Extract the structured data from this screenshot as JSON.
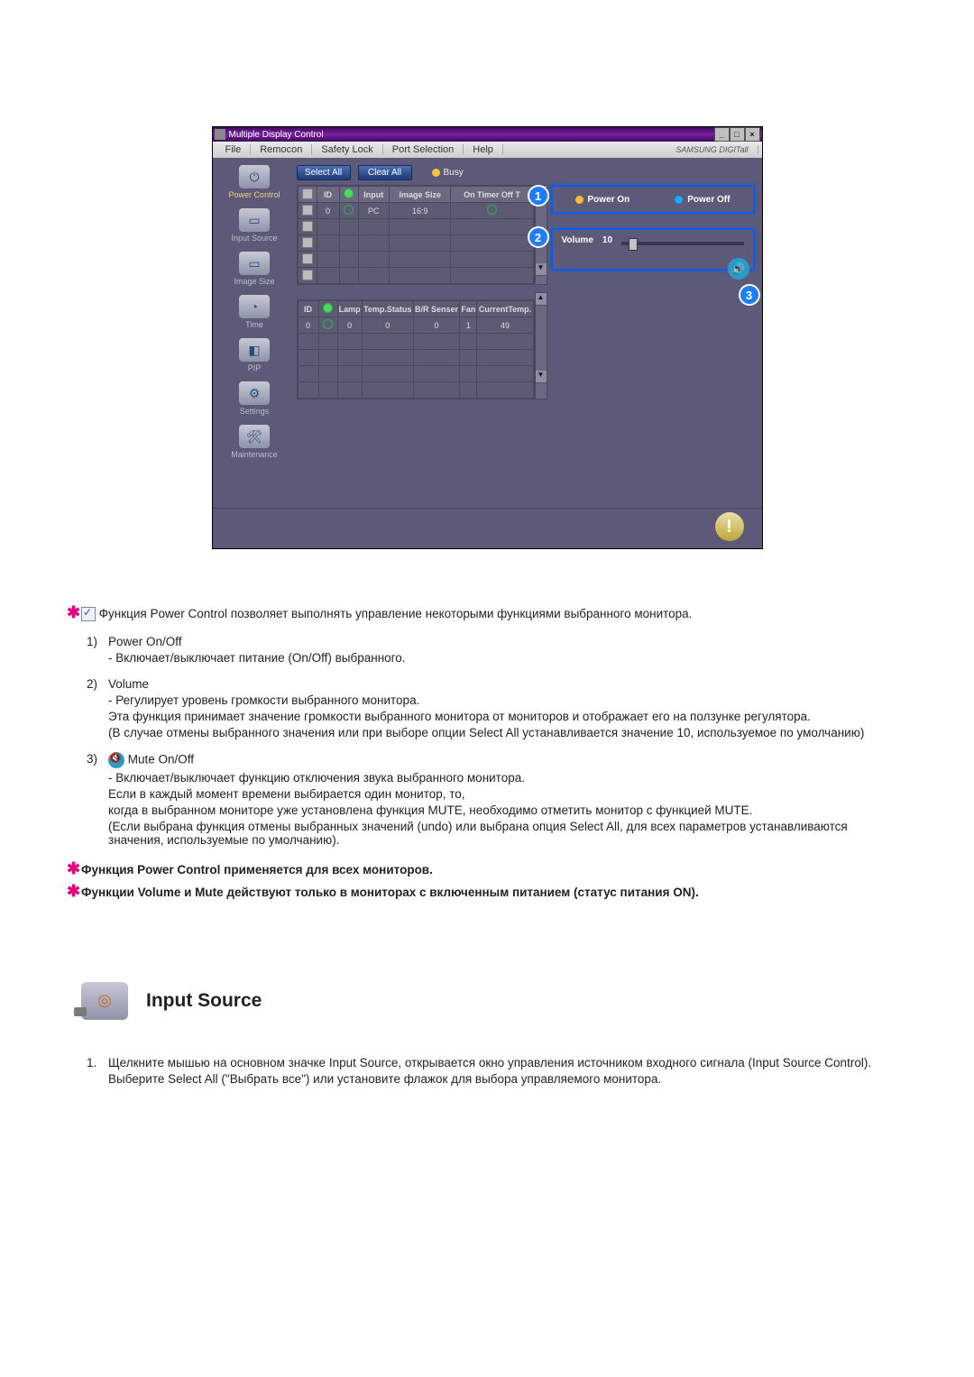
{
  "screenshot": {
    "title": "Multiple Display Control",
    "menu": [
      "File",
      "Remocon",
      "Safety Lock",
      "Port Selection",
      "Help"
    ],
    "brand": "SAMSUNG DIGITall",
    "sidebar": [
      {
        "label": "Power Control"
      },
      {
        "label": "Input Source"
      },
      {
        "label": "Image Size"
      },
      {
        "label": "Time"
      },
      {
        "label": "PIP"
      },
      {
        "label": "Settings"
      },
      {
        "label": "Maintenance"
      }
    ],
    "buttons": {
      "select_all": "Select All",
      "clear_all": "Clear All",
      "busy": "Busy"
    },
    "table1": {
      "headers": [
        "☑",
        "ID",
        "◉",
        "Input",
        "Image Size",
        "On Timer Off T"
      ],
      "rows": [
        [
          "",
          "0",
          "○",
          "PC",
          "16:9",
          "○"
        ],
        [
          "",
          "",
          "",
          "",
          "",
          ""
        ],
        [
          "",
          "",
          "",
          "",
          "",
          ""
        ],
        [
          "",
          "",
          "",
          "",
          "",
          ""
        ],
        [
          "",
          "",
          "",
          "",
          "",
          ""
        ]
      ]
    },
    "table2": {
      "headers": [
        "ID",
        "◉",
        "Lamp",
        "Temp.Status",
        "B/R Senser",
        "Fan",
        "CurrentTemp."
      ],
      "rows": [
        [
          "0",
          "○",
          "0",
          "0",
          "0",
          "1",
          "49"
        ],
        [
          "",
          "",
          "",
          "",
          "",
          "",
          ""
        ],
        [
          "",
          "",
          "",
          "",
          "",
          "",
          ""
        ],
        [
          "",
          "",
          "",
          "",
          "",
          "",
          ""
        ],
        [
          "",
          "",
          "",
          "",
          "",
          "",
          ""
        ]
      ]
    },
    "right": {
      "power_on": "Power On",
      "power_off": "Power Off",
      "volume_label": "Volume",
      "volume_value": "10"
    },
    "callouts": [
      "1",
      "2",
      "3"
    ]
  },
  "doc": {
    "intro": "Функция Power Control позволяет выполнять управление некоторыми функциями выбранного монитора.",
    "item1_title": "Power On/Off",
    "item1_line": "- Включает/выключает питание (On/Off) выбранного.",
    "item2_title": "Volume",
    "item2_l1": "- Регулирует уровень громкости выбранного монитора.",
    "item2_l2": "Эта функция принимает значение громкости выбранного монитора от мониторов и отображает его на ползунке регулятора.",
    "item2_l3": "(В случае отмены выбранного значения или при выборе опции Select All устанавливается значение 10, используемое по умолчанию)",
    "item3_title": "Mute On/Off",
    "item3_l1": "- Включает/выключает функцию отключения звука выбранного монитора.",
    "item3_l2": "Если в каждый момент времени выбирается один монитор, то,",
    "item3_l3": "когда в выбранном мониторе уже установлена функция MUTE, необходимо отметить монитор с функцией MUTE.",
    "item3_l4": "(Если выбрана функция отмены выбранных значений (undo) или выбрана опция Select All, для всех параметров устанавливаются значения, используемые по умолчанию).",
    "note1": "Функция Power Control применяется для всех мониторов.",
    "note2": "Функции Volume и Mute действуют только в мониторах с включенным питанием (статус питания ON).",
    "section2_title": "Input Source",
    "section2_p1": "Щелкните мышью на основном значке Input Source, открывается окно управления источником входного сигнала (Input Source Control).",
    "section2_p2": "Выберите Select All (\"Выбрать все\") или установите флажок для выбора управляемого монитора."
  }
}
